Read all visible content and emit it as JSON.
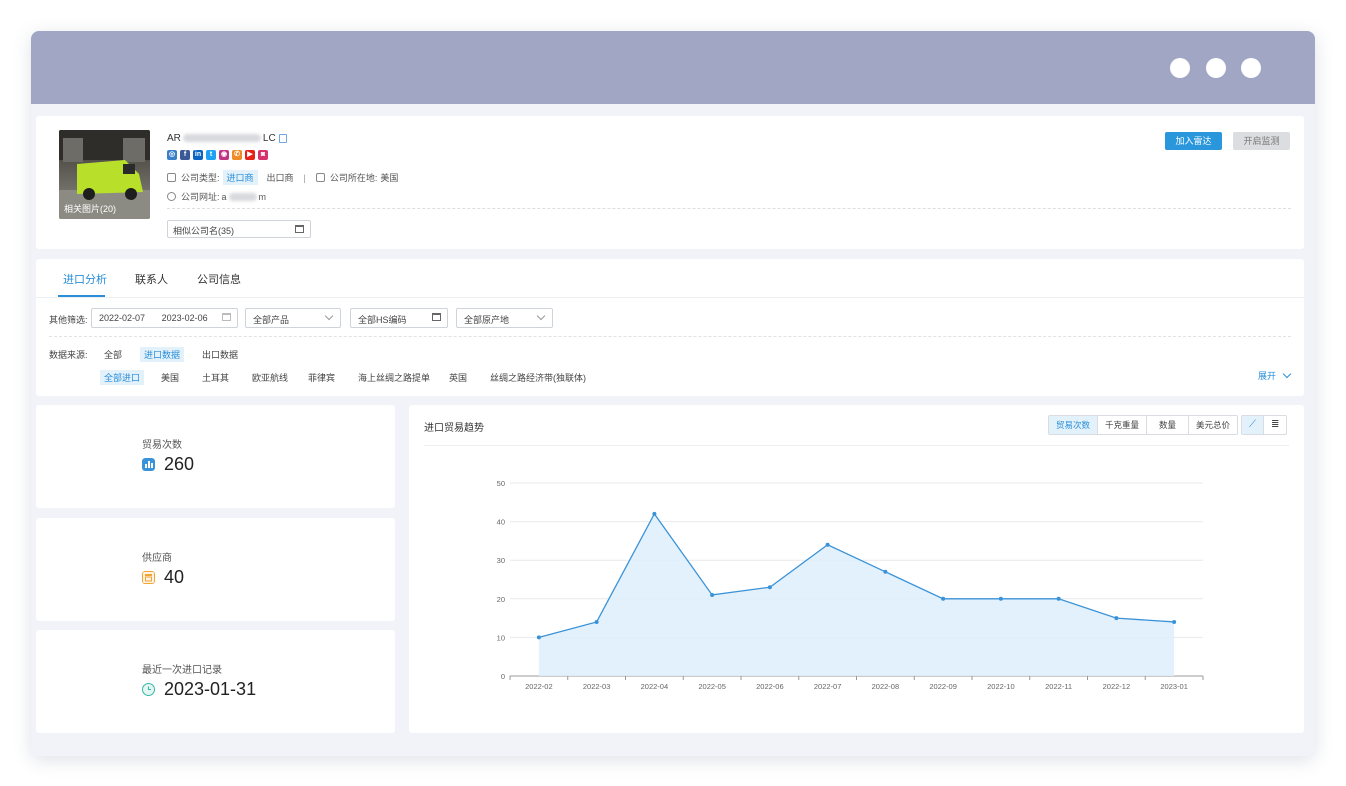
{
  "company": {
    "name_prefix": "AR",
    "name_suffix": "LC",
    "photo_label": "相关图片(20)",
    "type_label": "公司类型:",
    "type_importer": "进口商",
    "type_exporter": "出口商",
    "location_label": "公司所在地:",
    "location_value": "美国",
    "website_label": "公司网址:",
    "website_prefix": "a",
    "website_suffix": "m",
    "similar_label": "相似公司名(35)",
    "socials": [
      {
        "icon": "link-icon",
        "glyph": "◎",
        "color": "#3a80c9"
      },
      {
        "icon": "facebook-icon",
        "glyph": "f",
        "color": "#3b5998"
      },
      {
        "icon": "linkedin-icon",
        "glyph": "in",
        "color": "#0a66c2"
      },
      {
        "icon": "twitter-icon",
        "glyph": "t",
        "color": "#1da1f2"
      },
      {
        "icon": "instagram-icon",
        "glyph": "◉",
        "color": "#c13584"
      },
      {
        "icon": "phone-icon",
        "glyph": "✆",
        "color": "#f08a24"
      },
      {
        "icon": "youtube-icon",
        "glyph": "▶",
        "color": "#e62117"
      },
      {
        "icon": "camera-icon",
        "glyph": "◙",
        "color": "#d6336c"
      }
    ],
    "add_radar": "加入雷达",
    "start_monitor": "开启监测"
  },
  "tabs": [
    "进口分析",
    "联系人",
    "公司信息"
  ],
  "filters": {
    "other_label": "其他筛选:",
    "date_start": "2022-02-07",
    "date_end": "2023-02-06",
    "product": "全部产品",
    "hs_code": "全部HS编码",
    "origin": "全部原产地",
    "source_label": "数据来源:",
    "sources": [
      "全部",
      "进口数据",
      "出口数据"
    ],
    "regions": [
      "全部进口",
      "美国",
      "土耳其",
      "欧亚航线",
      "菲律宾",
      "海上丝绸之路提单",
      "英国",
      "丝绸之路经济带(独联体)"
    ],
    "expand": "展开"
  },
  "stats": {
    "trades_label": "贸易次数",
    "trades_value": "260",
    "suppliers_label": "供应商",
    "suppliers_value": "40",
    "last_import_label": "最近一次进口记录",
    "last_import_value": "2023-01-31"
  },
  "chart_panel": {
    "title": "进口贸易趋势",
    "metrics": [
      "贸易次数",
      "千克重量",
      "数量",
      "美元总价"
    ]
  },
  "chart_data": {
    "type": "area",
    "categories": [
      "2022-02",
      "2022-03",
      "2022-04",
      "2022-05",
      "2022-06",
      "2022-07",
      "2022-08",
      "2022-09",
      "2022-10",
      "2022-11",
      "2022-12",
      "2023-01"
    ],
    "values": [
      10,
      14,
      42,
      21,
      23,
      34,
      27,
      20,
      20,
      20,
      15,
      14
    ],
    "ylim": [
      0,
      50
    ],
    "yticks": [
      0,
      10,
      20,
      30,
      40,
      50
    ],
    "grid": true,
    "line_color": "#3a93d8",
    "fill_color": "#deeefb"
  }
}
